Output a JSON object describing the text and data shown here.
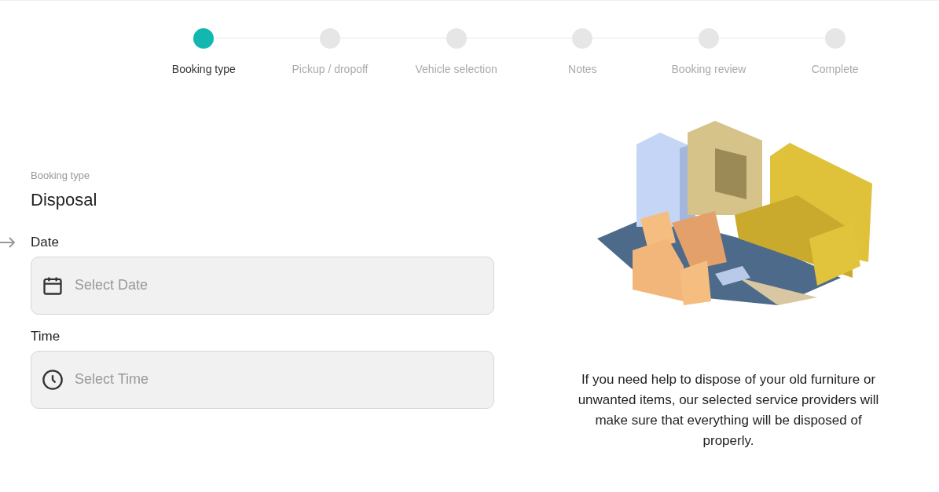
{
  "steps": [
    {
      "label": "Booking type",
      "selected": true
    },
    {
      "label": "Pickup / dropoff",
      "selected": false
    },
    {
      "label": "Vehicle selection",
      "selected": false
    },
    {
      "label": "Notes",
      "selected": false
    },
    {
      "label": "Booking review",
      "selected": false
    },
    {
      "label": "Complete",
      "selected": false
    }
  ],
  "booking_type": {
    "label": "Booking type",
    "value": "Disposal"
  },
  "fields": [
    {
      "kind": "date",
      "label": "Date",
      "placeholder": "Select Date",
      "pointed": true
    },
    {
      "kind": "time",
      "label": "Time",
      "placeholder": "Select Time",
      "pointed": false
    }
  ],
  "description": "If you need help to dispose of your old furniture or unwanted items, our selected service providers will make sure that everything will be disposed of properly."
}
